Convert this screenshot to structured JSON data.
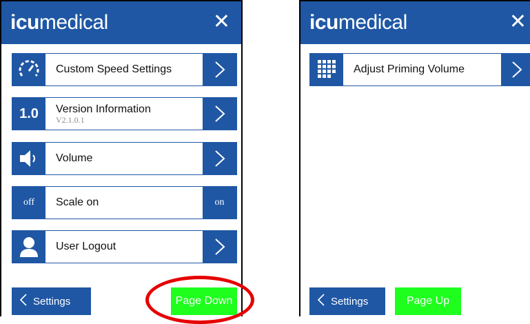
{
  "left_screen": {
    "brand": {
      "bold": "icu",
      "thin": "medical"
    },
    "close_icon": "close-icon",
    "rows": [
      {
        "icon": "speedometer-icon",
        "label": "Custom Speed Settings",
        "sub": ""
      },
      {
        "icon": "version-icon",
        "icon_text": "1.0",
        "label": "Version Information",
        "sub": "V2.1.0.1"
      },
      {
        "icon": "speaker-icon",
        "label": "Volume",
        "sub": ""
      },
      {
        "icon": "toggle",
        "off_label": "off",
        "label": "Scale on",
        "on_label": "on"
      },
      {
        "icon": "user-icon",
        "label": "User Logout",
        "sub": ""
      }
    ],
    "settings_button": "Settings",
    "page_button": "Page Down"
  },
  "right_screen": {
    "brand": {
      "bold": "icu",
      "thin": "medical"
    },
    "close_icon": "close-icon",
    "rows": [
      {
        "icon": "keypad-icon",
        "label": "Adjust Priming Volume",
        "sub": ""
      }
    ],
    "settings_button": "Settings",
    "page_button": "Page Up"
  },
  "colors": {
    "primary_blue": "#1f57a4",
    "page_button_green": "#1eff1e",
    "highlight_red": "#e60000"
  }
}
